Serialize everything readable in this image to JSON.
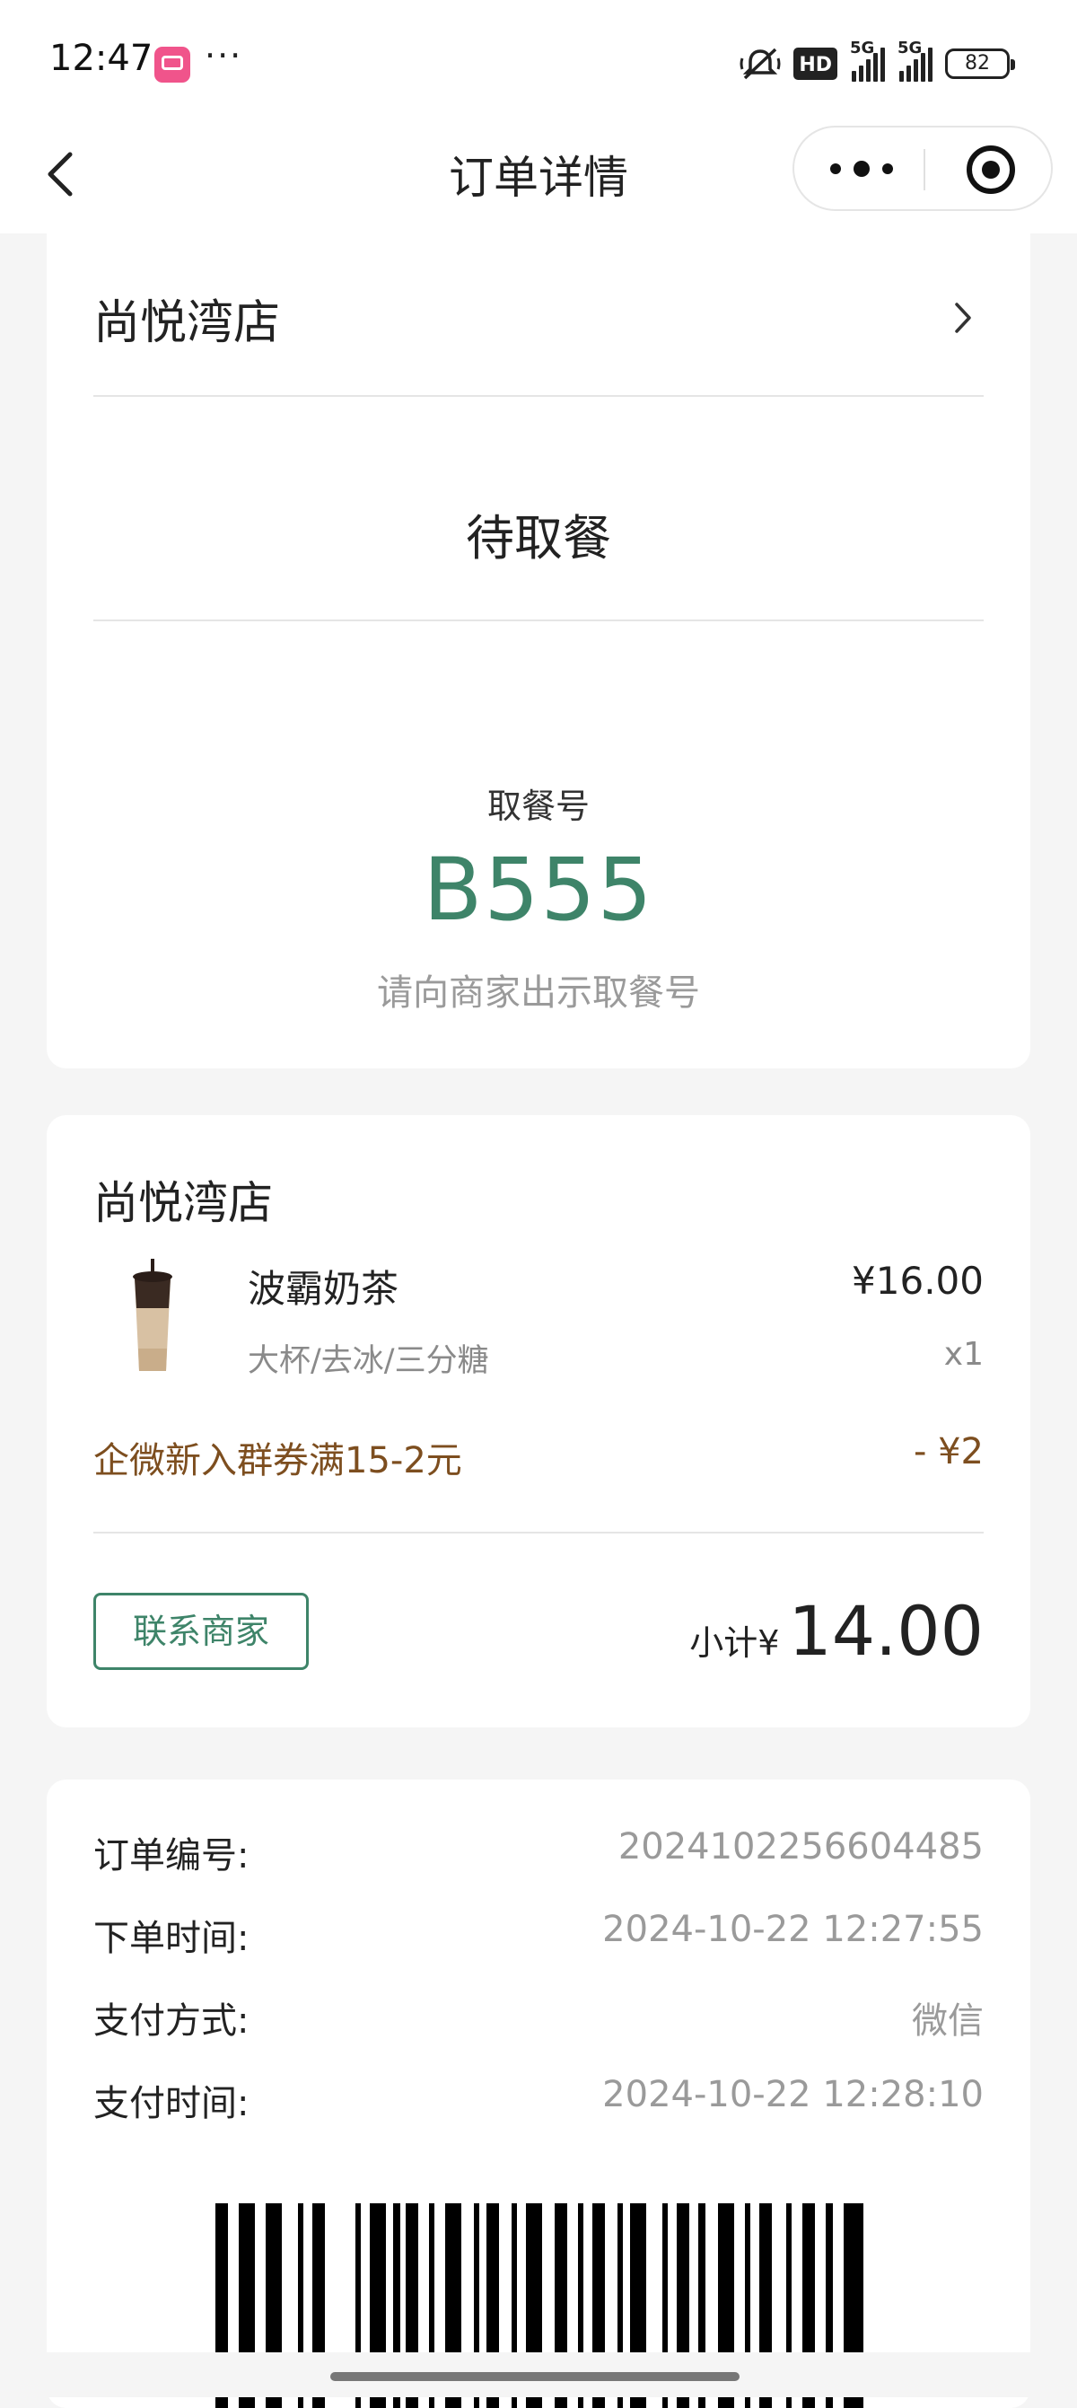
{
  "status_bar": {
    "time": "12:47",
    "menu_dots": "···",
    "hd_label": "HD",
    "network_1": "5G",
    "network_2": "5G",
    "battery": "82"
  },
  "nav": {
    "title": "订单详情"
  },
  "status_card": {
    "store_name": "尚悦湾店",
    "order_status": "待取餐",
    "pickup_label": "取餐号",
    "pickup_number": "B555",
    "pickup_hint": "请向商家出示取餐号"
  },
  "order_card": {
    "store_name": "尚悦湾店",
    "items": [
      {
        "name": "波霸奶茶",
        "spec": "大杯/去冰/三分糖",
        "price": "¥16.00",
        "qty": "x1"
      }
    ],
    "coupon": {
      "name": "企微新入群券满15-2元",
      "amount": "- ¥2"
    },
    "contact_label": "联系商家",
    "subtotal_label": "小计¥",
    "subtotal_value": "14.00"
  },
  "info_card": {
    "rows": [
      {
        "label": "订单编号:",
        "value": "2024102256604485"
      },
      {
        "label": "下单时间:",
        "value": "2024-10-22 12:27:55"
      },
      {
        "label": "支付方式:",
        "value": "微信"
      },
      {
        "label": "支付时间:",
        "value": "2024-10-22 12:28:10"
      }
    ]
  },
  "colors": {
    "accent_green": "#3e8469",
    "coupon_brown": "#7d4e1f",
    "background": "#f5f5f5"
  },
  "icons": [
    "back-arrow-icon",
    "more-dots-icon",
    "target-icon",
    "chevron-right-icon",
    "mute-icon",
    "signal-icon",
    "battery-icon",
    "barcode"
  ]
}
